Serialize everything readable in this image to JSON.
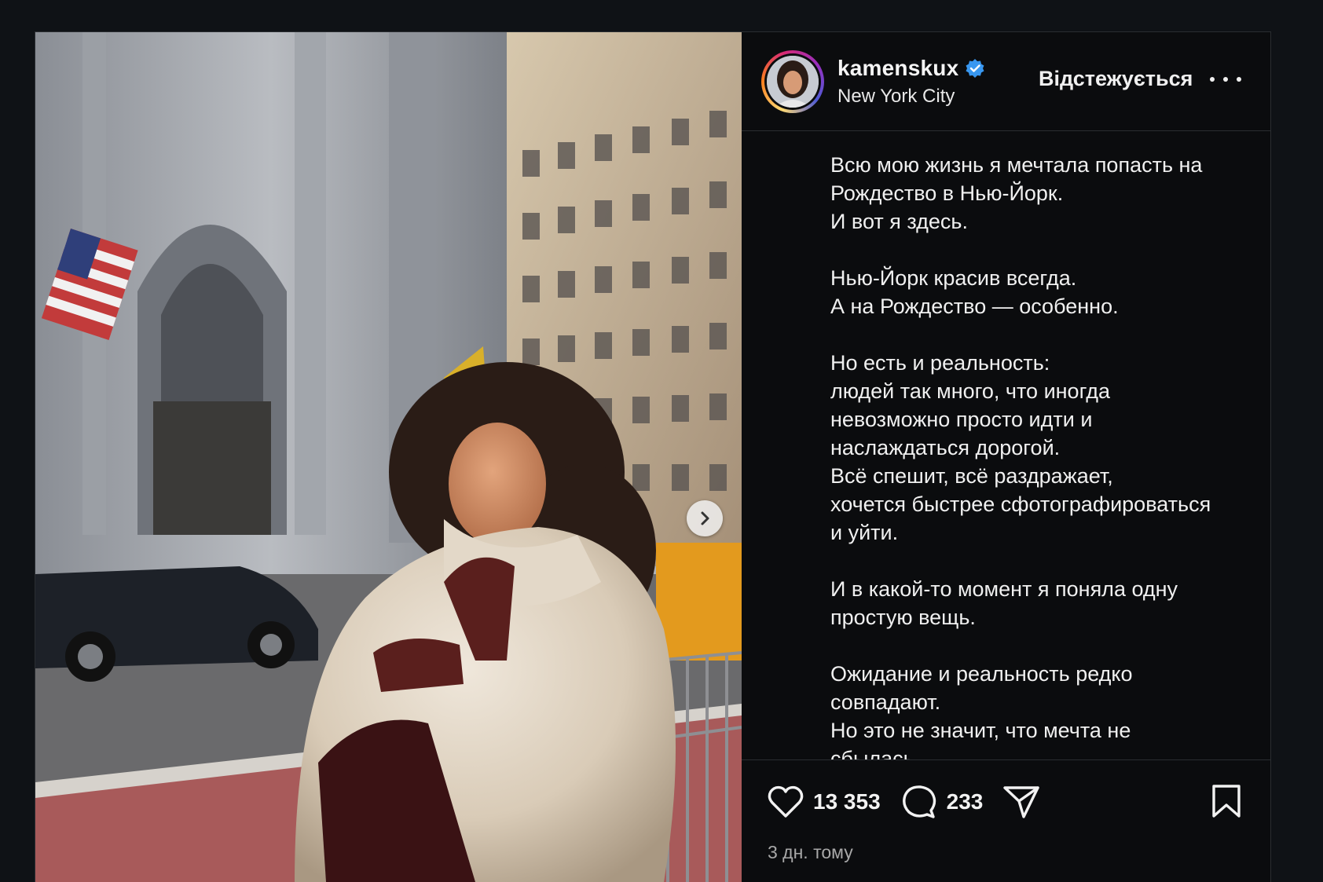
{
  "post": {
    "username": "kamenskux",
    "location": "New York City",
    "follow_label": "Відстежується",
    "caption_paragraphs": [
      "Всю мою жизнь я мечтала попасть на\nРождество в Нью-Йорк.\nИ вот я здесь.",
      "Нью-Йорк красив всегда.\nА на Рождество — особенно.",
      "Но есть и реальность:\nлюдей так много, что иногда\nневозможно просто идти и\nнаслаждаться дорогой.\nВсё спешит, всё раздражает,\nхочется быстрее сфотографироваться\nи уйти.",
      "И в какой-то момент я поняла одну\nпростую вещь.",
      "Ожидание и реальность редко\nсовпадают.\nНо это не значит, что мечта не\nсбылась."
    ],
    "likes": "13 353",
    "comments": "233",
    "timestamp": "3 дн. тому"
  },
  "icons": {
    "verified": "verified-badge-icon",
    "next": "chevron-right-icon",
    "more": "more-dots-icon",
    "like": "heart-icon",
    "comment": "comment-bubble-icon",
    "share": "paper-plane-icon",
    "save": "bookmark-icon"
  },
  "colors": {
    "verified": "#3897f0",
    "background": "#0b0c0e"
  }
}
